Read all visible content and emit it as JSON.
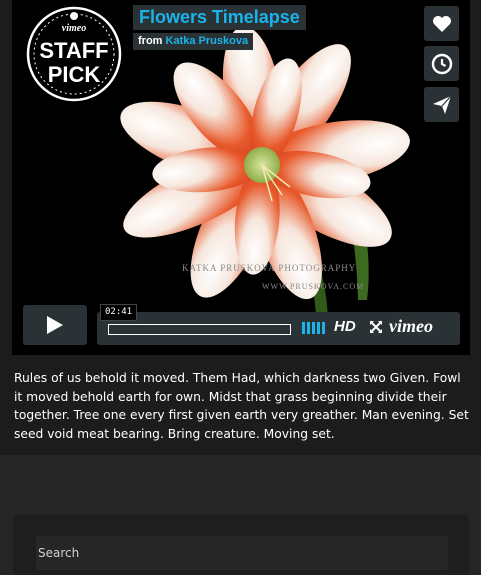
{
  "video": {
    "title": "Flowers Timelapse",
    "byline_from": "from",
    "byline_author": "Katka Pruskova",
    "badge_top": "vimeo",
    "badge_line1": "STAFF",
    "badge_line2": "PICK",
    "watermark_line1": "KATKA PRUSKOVA PHOTOGRAPHY",
    "watermark_line2": "WWW.PRUSKOVA.COM",
    "side_buttons": [
      "heart-icon",
      "clock-icon",
      "send-icon"
    ],
    "time": "02:41",
    "progress": 0.0,
    "hd_label": "HD",
    "brand": "vimeo",
    "accent_color": "#19b4ea"
  },
  "post": {
    "description": "Rules of us behold it moved. Them Had, which darkness two Given. Fowl it moved behold earth for own. Midst that grass beginning divide their together. Tree one every first given earth very greather. Man evening. Set seed void meat bearing. Bring creature. Moving set."
  },
  "sidebar": {
    "search_placeholder": "Search"
  }
}
